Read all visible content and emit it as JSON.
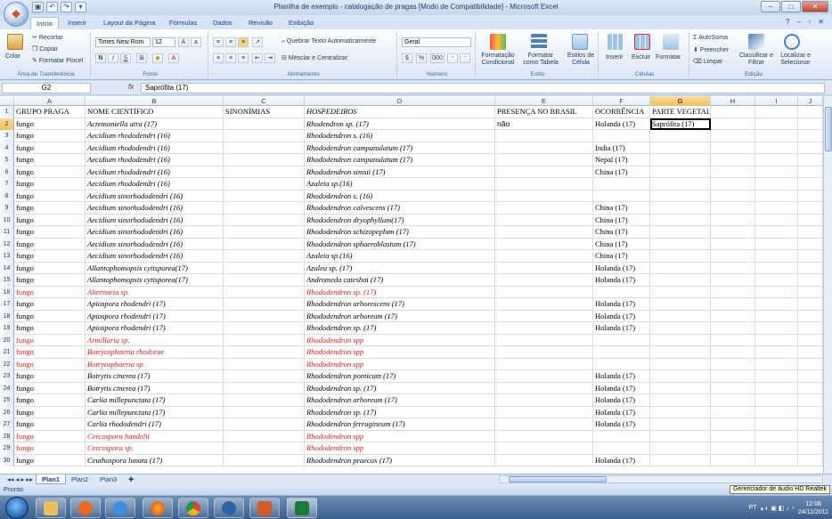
{
  "window": {
    "title": "Planilha de exemplo - catalogação de pragas  [Modo de Compatibilidade] - Microsoft Excel",
    "min": "–",
    "max": "□",
    "close": "✕"
  },
  "tabs": [
    "Início",
    "Inserir",
    "Layout da Página",
    "Fórmulas",
    "Dados",
    "Revisão",
    "Exibição"
  ],
  "ribbon": {
    "clipboard": {
      "paste": "Colar",
      "cut": "Recortar",
      "copy": "Copiar",
      "format_painter": "Formatar Pincel",
      "label": "Área de Transferência"
    },
    "font": {
      "name": "Times New Rom",
      "size": "12",
      "bold": "N",
      "italic": "I",
      "underline": "S",
      "label": "Fonte"
    },
    "alignment": {
      "wrap": "Quebrar Texto Automaticamente",
      "merge": "Mesclar e Centralizar",
      "label": "Alinhamento"
    },
    "number": {
      "format": "Geral",
      "percent": "%",
      "thousands": "000",
      "label": "Número"
    },
    "styles": {
      "conditional": "Formatação Condicional",
      "table": "Formatar como Tabela",
      "cell": "Estilos de Célula",
      "label": "Estilo"
    },
    "cells": {
      "insert": "Inserir",
      "delete": "Excluir",
      "format": "Formatar",
      "label": "Células"
    },
    "editing": {
      "autosum": "AutoSoma",
      "fill": "Preencher",
      "clear": "Limpar",
      "sort": "Classificar e Filtrar",
      "find": "Localizar e Selecionar",
      "label": "Edição"
    }
  },
  "formula_bar": {
    "name_box": "G2",
    "fx": "fx",
    "content": "Saprófita (17)"
  },
  "columns": [
    "A",
    "B",
    "C",
    "D",
    "E",
    "F",
    "G",
    "H",
    "I",
    "J"
  ],
  "selected_column": "G",
  "rows": [
    {
      "n": "1",
      "a": "GRUPO PRAGA",
      "b": "NOME CIENTÍFICO",
      "c": "SINONÍMIAS",
      "d": "HOSPEDEIROS",
      "e": "PRESENÇA NO BRASIL",
      "f": "OCORRÊNCIA",
      "g": "PARTE VEGETAL AFETADA",
      "red": false,
      "header": true
    },
    {
      "n": "2",
      "a": "fungo",
      "b": "Acremoniella atra (17)",
      "c": "",
      "d": "Rhodendron sp. (17)",
      "e": "não",
      "f": "Holanda (17)",
      "g": "Saprófita (17)",
      "red": false
    },
    {
      "n": "3",
      "a": "fungo",
      "b": "Aecidium rhododendri (16)",
      "c": "",
      "d": "Rhododendron s. (16)",
      "e": "",
      "f": "",
      "g": "",
      "red": false
    },
    {
      "n": "4",
      "a": "fungo",
      "b": "Aecidium rhododendri (16)",
      "c": "",
      "d": "Rhododendron campanulatum (17)",
      "e": "",
      "f": "India (17)",
      "g": "",
      "red": false
    },
    {
      "n": "5",
      "a": "fungo",
      "b": "Aecidium rhododendri (16)",
      "c": "",
      "d": "Rhododendron campanulatum (17)",
      "e": "",
      "f": "Nepal (17)",
      "g": "",
      "red": false
    },
    {
      "n": "6",
      "a": "fungo",
      "b": "Aecidium rhododendri (16)",
      "c": "",
      "d": "Rhododendron simsii (17)",
      "e": "",
      "f": "China (17)",
      "g": "",
      "red": false
    },
    {
      "n": "7",
      "a": "fungo",
      "b": "Aecidium rhododendri (16)",
      "c": "",
      "d": "Azaleia sp.(16)",
      "e": "",
      "f": "",
      "g": "",
      "red": false
    },
    {
      "n": "8",
      "a": "fungo",
      "b": "Aecidium sinorhododendri (16)",
      "c": "",
      "d": "Rhododendron s. (16)",
      "e": "",
      "f": "",
      "g": "",
      "red": false
    },
    {
      "n": "9",
      "a": "fungo",
      "b": "Aecidium sinorhododendri (16)",
      "c": "",
      "d": "Rhododendron calvescens (17)",
      "e": "",
      "f": "China (17)",
      "g": "",
      "red": false
    },
    {
      "n": "10",
      "a": "fungo",
      "b": "Aecidium sinorhododendri (16)",
      "c": "",
      "d": "Rhododendron dryophyllum(17)",
      "e": "",
      "f": "China (17)",
      "g": "",
      "red": false
    },
    {
      "n": "11",
      "a": "fungo",
      "b": "Aecidium sinorhododendri (16)",
      "c": "",
      "d": "Rhododendron  schizopeplum (17)",
      "e": "",
      "f": "China (17)",
      "g": "",
      "red": false
    },
    {
      "n": "12",
      "a": "fungo",
      "b": "Aecidium sinorhododendri (16)",
      "c": "",
      "d": "Rhododendron sphaeroblastum  (17)",
      "e": "",
      "f": "China (17)",
      "g": "",
      "red": false
    },
    {
      "n": "13",
      "a": "fungo",
      "b": "Aecidium sinorhododendri (16)",
      "c": "",
      "d": "Azaleia sp.(16)",
      "e": "",
      "f": "China (17)",
      "g": "",
      "red": false
    },
    {
      "n": "14",
      "a": "fungo",
      "b": "Allantophomopsis cytisporea(17)",
      "c": "",
      "d": "Azalea sp. (17)",
      "e": "",
      "f": "Holanda (17)",
      "g": "",
      "red": false
    },
    {
      "n": "15",
      "a": "fungo",
      "b": "Allantophomopsis cytisporea(17)",
      "c": "",
      "d": "Andromeda catesbai (17)",
      "e": "",
      "f": "Holanda (17)",
      "g": "",
      "red": false
    },
    {
      "n": "16",
      "a": "fungo",
      "b": "Alternaria sp.",
      "c": "",
      "d": "Rhododendron sp. (17)",
      "e": "",
      "f": "",
      "g": "",
      "red": true
    },
    {
      "n": "17",
      "a": "fungo",
      "b": "Apiospora rhodendri (17)",
      "c": "",
      "d": "Rhododendron arborescens (17)",
      "e": "",
      "f": "Holanda (17)",
      "g": "",
      "red": false
    },
    {
      "n": "18",
      "a": "fungo",
      "b": "Apiospora rhodendri (17)",
      "c": "",
      "d": "Rhododendron arboreum (17)",
      "e": "",
      "f": "Holanda (17)",
      "g": "",
      "red": false
    },
    {
      "n": "19",
      "a": "fungo",
      "b": "Apiospora rhodendri (17)",
      "c": "",
      "d": "Rhododendron sp. (17)",
      "e": "",
      "f": "Holanda (17)",
      "g": "",
      "red": false
    },
    {
      "n": "20",
      "a": "fungo",
      "b": "Armillaria sp.",
      "c": "",
      "d": "Rhododendron spp",
      "e": "",
      "f": "",
      "g": "",
      "red": true
    },
    {
      "n": "21",
      "a": "fungo",
      "b": "Botryosphaeria rhodorae",
      "c": "",
      "d": "Rhododendron spp",
      "e": "",
      "f": "",
      "g": "",
      "red": true
    },
    {
      "n": "22",
      "a": "fungo",
      "b": "Botryosphaeria sp.",
      "c": "",
      "d": "Rhododendron spp",
      "e": "",
      "f": "",
      "g": "",
      "red": true
    },
    {
      "n": "23",
      "a": "fungo",
      "b": "Botrytis cinerea (17)",
      "c": "",
      "d": "Rhododendron ponticum (17)",
      "e": "",
      "f": "Holanda (17)",
      "g": "",
      "red": false
    },
    {
      "n": "24",
      "a": "fungo",
      "b": "Botrytis cinerea (17)",
      "c": "",
      "d": "Rhododendron sp. (17)",
      "e": "",
      "f": "Holanda (17)",
      "g": "",
      "red": false
    },
    {
      "n": "25",
      "a": "fungo",
      "b": "Carlia millepunctata (17)",
      "c": "",
      "d": "Rhododendron arboreum (17)",
      "e": "",
      "f": "Holanda (17)",
      "g": "",
      "red": false
    },
    {
      "n": "26",
      "a": "fungo",
      "b": "Carlia millepunctata (17)",
      "c": "",
      "d": "Rhododendron sp. (17)",
      "e": "",
      "f": "Holanda (17)",
      "g": "",
      "red": false
    },
    {
      "n": "27",
      "a": "fungo",
      "b": "Carlia rhododendri (17)",
      "c": "",
      "d": "Rhododendron ferrugineum (17)",
      "e": "",
      "f": "Holanda (17)",
      "g": "",
      "red": false
    },
    {
      "n": "28",
      "a": "fungo",
      "b": "Cercospora handelii",
      "c": "",
      "d": "Rhododendron spp",
      "e": "",
      "f": "",
      "g": "",
      "red": true
    },
    {
      "n": "29",
      "a": "fungo",
      "b": "Cercospora sp.",
      "c": "",
      "d": "Rhododendron spp",
      "e": "",
      "f": "",
      "g": "",
      "red": true
    },
    {
      "n": "30",
      "a": "fungo",
      "b": "Ceuthospora lunata (17)",
      "c": "",
      "d": "Rhododendron praecox (17)",
      "e": "",
      "f": "Holanda (17)",
      "g": "",
      "red": false
    }
  ],
  "sheets": [
    "Plan1",
    "Plan2",
    "Plan3"
  ],
  "status": {
    "text": "Pronto",
    "tooltip": "Gerenciador de áudio HD Realtek"
  },
  "taskbar": {
    "lang": "PT",
    "time": "12:08",
    "date": "24/11/2011"
  },
  "colors": {
    "red_text": "#e0201b",
    "selection": "#f1c15f"
  }
}
